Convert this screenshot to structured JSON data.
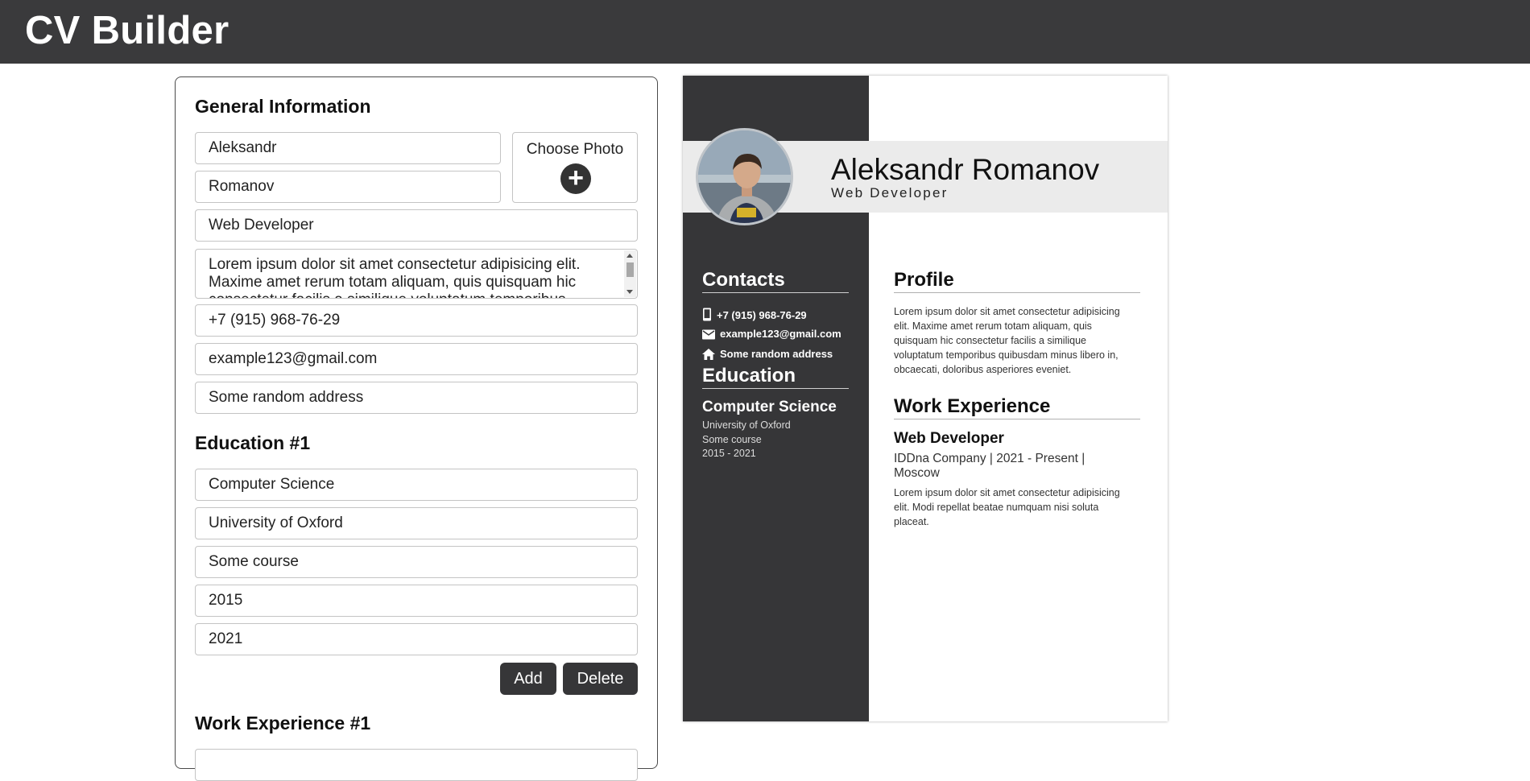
{
  "app": {
    "title": "CV Builder"
  },
  "editor": {
    "general": {
      "heading": "General Information",
      "first_name": "Aleksandr",
      "last_name": "Romanov",
      "photo_label": "Choose Photo",
      "job_title": "Web Developer",
      "description": "Lorem ipsum dolor sit amet consectetur adipisicing elit. Maxime amet rerum totam aliquam, quis quisquam hic consectetur facilis a similique voluptatum temporibus",
      "phone": "+7 (915) 968-76-29",
      "email": "example123@gmail.com",
      "address": "Some random address"
    },
    "education": {
      "heading": "Education #1",
      "degree": "Computer Science",
      "university": "University of Oxford",
      "course": "Some course",
      "start": "2015",
      "end": "2021",
      "add_label": "Add",
      "delete_label": "Delete"
    },
    "work": {
      "heading": "Work Experience #1"
    }
  },
  "cv": {
    "name": "Aleksandr Romanov",
    "job": "Web Developer",
    "contacts_heading": "Contacts",
    "phone": "+7 (915) 968-76-29",
    "email": "example123@gmail.com",
    "address": "Some random address",
    "education_heading": "Education",
    "edu_degree": "Computer Science",
    "edu_university": "University of Oxford",
    "edu_course": "Some course",
    "edu_years": "2015 - 2021",
    "profile_heading": "Profile",
    "profile_text": "Lorem ipsum dolor sit amet consectetur adipisicing elit. Maxime amet rerum totam aliquam, quis quisquam hic consectetur facilis a similique voluptatum temporibus quibusdam minus libero in, obcaecati, doloribus asperiores eveniet.",
    "work_heading": "Work Experience",
    "work_title": "Web Developer",
    "work_meta": "IDDna Company | 2021 - Present | Moscow",
    "work_text": "Lorem ipsum dolor sit amet consectetur adipisicing elit. Modi repellat beatae numquam nisi soluta placeat."
  },
  "icons": {
    "phone": "phone-icon",
    "email": "email-icon",
    "address": "home-icon",
    "photo": "plus-icon"
  },
  "colors": {
    "header": "#3a3a3c",
    "sidebar": "#363638",
    "band": "#ebebeb",
    "button": "#363638"
  }
}
